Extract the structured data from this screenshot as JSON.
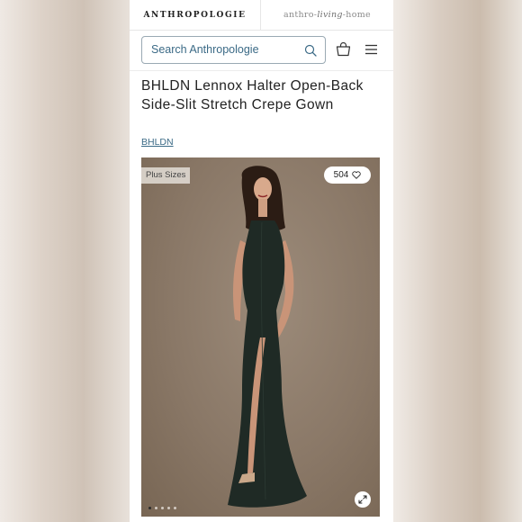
{
  "header": {
    "brand_main": "ANTHROPOLOGIE",
    "brand_alt_prefix": "anthro-",
    "brand_alt_script": "living",
    "brand_alt_suffix": "-home"
  },
  "search": {
    "placeholder": "Search Anthropologie"
  },
  "product": {
    "title": "BHLDN Lennox Halter Open-Back Side-Slit Stretch Crepe Gown",
    "brand": "BHLDN",
    "badge": "Plus Sizes",
    "favorites_count": "504",
    "image_count": 5,
    "active_image": 1,
    "colors": {
      "link": "#3b6a86",
      "gown": "#1f2a25"
    }
  },
  "icons": {
    "search": "search-icon",
    "bag": "shopping-bag-icon",
    "menu": "hamburger-menu-icon",
    "heart": "heart-icon",
    "expand": "expand-icon"
  }
}
